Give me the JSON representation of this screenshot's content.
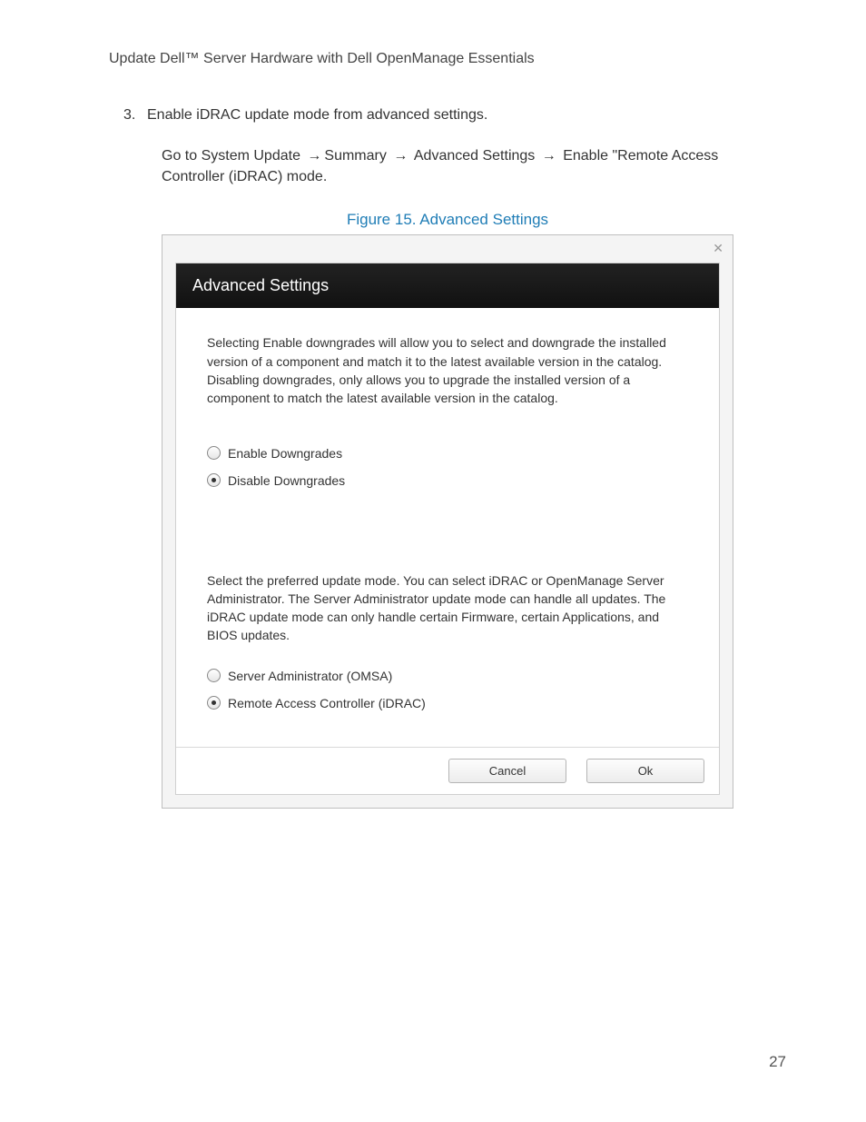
{
  "doc_header": "Update Dell™ Server Hardware with Dell OpenManage Essentials",
  "list": {
    "num": "3.",
    "text": "Enable iDRAC update mode from advanced settings."
  },
  "nav_para_prefix": "Go to System Update ",
  "nav_parts": {
    "p1": "Summary ",
    "p2": " Advanced Settings ",
    "p3": " Enable \"Remote Access Controller (iDRAC) mode."
  },
  "arrow": "→",
  "figure_caption": "Figure 15. Advanced Settings",
  "dialog": {
    "close_glyph": "✕",
    "title": "Advanced Settings",
    "downgrades_desc": "Selecting Enable downgrades will allow you to select and downgrade the installed version of a component and match it to the latest available version in the catalog. Disabling downgrades, only allows you to upgrade the installed version of a component to match the latest available version in the catalog.",
    "radio_enable_downgrades": "Enable Downgrades",
    "radio_disable_downgrades": "Disable Downgrades",
    "update_mode_desc": "Select the preferred update mode. You can select iDRAC or OpenManage Server Administrator. The Server Administrator update mode can handle all updates. The iDRAC update mode can only handle certain Firmware, certain Applications, and BIOS updates.",
    "radio_omsa": "Server Administrator (OMSA)",
    "radio_idrac": "Remote Access Controller (iDRAC)",
    "btn_cancel": "Cancel",
    "btn_ok": "Ok"
  },
  "page_number": "27"
}
